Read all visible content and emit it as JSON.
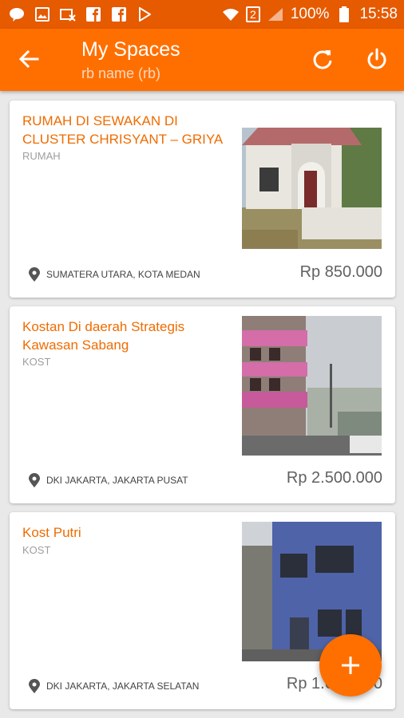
{
  "status_bar": {
    "battery": "100%",
    "time": "15:58",
    "sim": "2",
    "icons": [
      "line-icon",
      "image-icon",
      "missed-call-icon",
      "facebook-icon",
      "facebook-icon",
      "play-store-icon",
      "wifi-icon",
      "signal-icon",
      "battery-icon"
    ]
  },
  "app_bar": {
    "title": "My Spaces",
    "subtitle": "rb name (rb)",
    "color": "#ff6f00"
  },
  "listings": [
    {
      "title": "RUMAH DI SEWAKAN DI CLUSTER CHRISYANT – GRIYA",
      "type": "RUMAH",
      "location": "SUMATERA UTARA, KOTA MEDAN",
      "price": "Rp 850.000"
    },
    {
      "title": "Kostan Di daerah Strategis Kawasan Sabang",
      "type": "KOST",
      "location": "DKI JAKARTA, JAKARTA PUSAT",
      "price": "Rp 2.500.000"
    },
    {
      "title": "Kost Putri",
      "type": "KOST",
      "location": "DKI JAKARTA, JAKARTA SELATAN",
      "price": "Rp 1.600.000"
    }
  ],
  "fab": {
    "icon": "plus-icon"
  },
  "colors": {
    "accent": "#ff6f00",
    "title_text": "#ef6c00",
    "status_bar": "#e65a00"
  }
}
